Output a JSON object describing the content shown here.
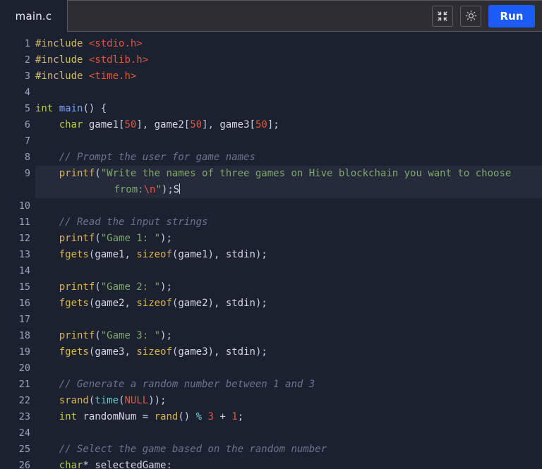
{
  "window": {
    "background_color": "#1c2130",
    "header_color": "#2e2e32"
  },
  "tab": {
    "label": "main.c",
    "active": true
  },
  "toolbar": {
    "collapse_icon": "collapse-arrows-icon",
    "theme_icon": "sun-icon",
    "run_label": "Run",
    "run_color": "#1a5cf5"
  },
  "editor": {
    "language": "c",
    "active_line": 9,
    "cursor_after_text": "S",
    "theme_colors": {
      "background": "#1c2130",
      "active_line": "#262b3b",
      "gutter_text": "#9aa4bd",
      "preprocessor": "#d4bb6a",
      "include_path": "#e0583d",
      "type_keyword": "#b7c94e",
      "function": "#d9b34a",
      "string": "#7fa86a",
      "number": "#e0583d",
      "comment": "#6b7490",
      "identifier": "#d4d7e0"
    },
    "lines": [
      {
        "n": "1",
        "text": "#include <stdio.h>"
      },
      {
        "n": "2",
        "text": "#include <stdlib.h>"
      },
      {
        "n": "3",
        "text": "#include <time.h>"
      },
      {
        "n": "4",
        "text": ""
      },
      {
        "n": "5",
        "text": "int main() {",
        "fold": true
      },
      {
        "n": "6",
        "text": "    char game1[50], game2[50], game3[50];"
      },
      {
        "n": "7",
        "text": ""
      },
      {
        "n": "8",
        "text": "    // Prompt the user for game names"
      },
      {
        "n": "9",
        "text": "    printf(\"Write the names of three games on Hive blockchain you want to choose from:\\n\");S"
      },
      {
        "n": "10",
        "text": ""
      },
      {
        "n": "11",
        "text": "    // Read the input strings"
      },
      {
        "n": "12",
        "text": "    printf(\"Game 1: \");"
      },
      {
        "n": "13",
        "text": "    fgets(game1, sizeof(game1), stdin);"
      },
      {
        "n": "14",
        "text": ""
      },
      {
        "n": "15",
        "text": "    printf(\"Game 2: \");"
      },
      {
        "n": "16",
        "text": "    fgets(game2, sizeof(game2), stdin);"
      },
      {
        "n": "17",
        "text": ""
      },
      {
        "n": "18",
        "text": "    printf(\"Game 3: \");"
      },
      {
        "n": "19",
        "text": "    fgets(game3, sizeof(game3), stdin);"
      },
      {
        "n": "20",
        "text": ""
      },
      {
        "n": "21",
        "text": "    // Generate a random number between 1 and 3"
      },
      {
        "n": "22",
        "text": "    srand(time(NULL));"
      },
      {
        "n": "23",
        "text": "    int randomNum = rand() % 3 + 1;"
      },
      {
        "n": "24",
        "text": ""
      },
      {
        "n": "25",
        "text": "    // Select the game based on the random number"
      },
      {
        "n": "26",
        "text": "    char* selectedGame:"
      }
    ],
    "line_numbers": [
      "1",
      "2",
      "3",
      "4",
      "5",
      "6",
      "7",
      "8",
      "9",
      "10",
      "11",
      "12",
      "13",
      "14",
      "15",
      "16",
      "17",
      "18",
      "19",
      "20",
      "21",
      "22",
      "23",
      "24",
      "25",
      "26"
    ],
    "line9_segments": {
      "part1": "printf(",
      "str_open": "\"Write the names of three games on Hive blockchain you want to choose",
      "str_cont": "        from:",
      "escape": "\\n",
      "str_close": "\"",
      "tail": ");",
      "typed": "S"
    }
  }
}
